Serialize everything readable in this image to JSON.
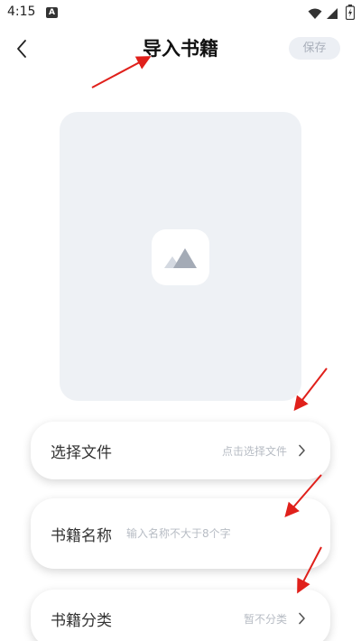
{
  "status_bar": {
    "time": "4:15",
    "notification_icon": "a-icon"
  },
  "header": {
    "title": "导入书籍",
    "save_label": "保存",
    "back_icon": "chevron-left-icon"
  },
  "cover": {
    "icon": "image-placeholder-icon"
  },
  "form": {
    "file": {
      "label": "选择文件",
      "value": "点击选择文件",
      "icon": "chevron-right-icon"
    },
    "name": {
      "label": "书籍名称",
      "placeholder": "输入名称不大于8个字"
    },
    "category": {
      "label": "书籍分类",
      "value": "暂不分类",
      "icon": "chevron-right-icon"
    }
  },
  "colors": {
    "annotation_arrow": "#e0201b",
    "save_button_bg": "#eceff4",
    "cover_bg": "#eef1f5",
    "placeholder_text": "#b7bcc4"
  }
}
